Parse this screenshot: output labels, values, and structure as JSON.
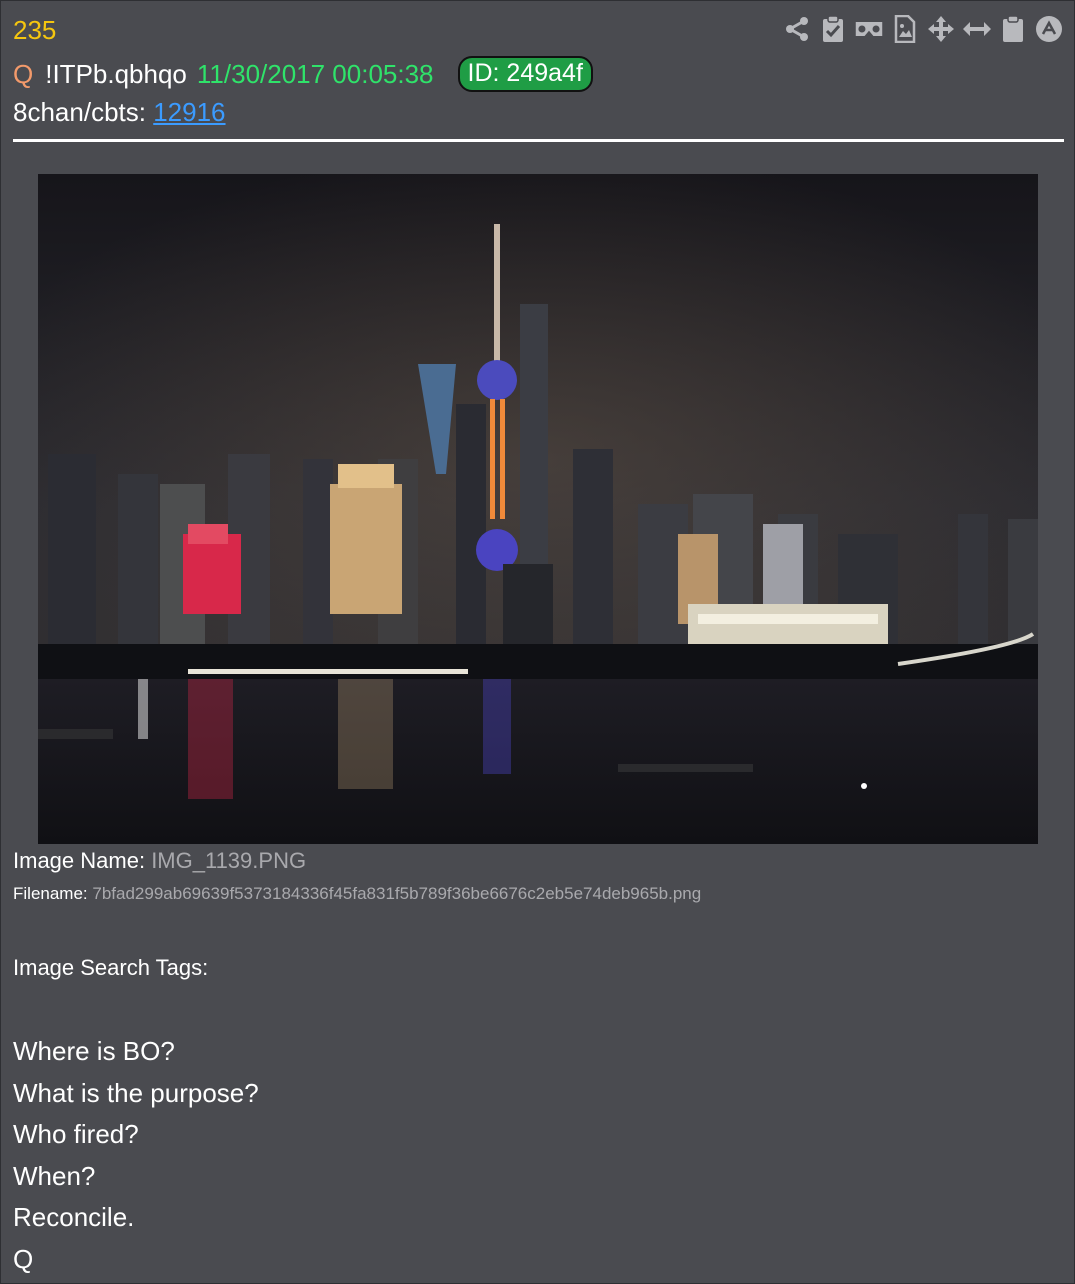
{
  "post": {
    "number": "235",
    "author_mark": "Q",
    "tripcode": "!ITPb.qbhqo",
    "timestamp": "11/30/2017 00:05:38",
    "id_badge": "ID: 249a4f",
    "board_label": "8chan/cbts:",
    "board_link": "12916"
  },
  "toolbar": {
    "icons": [
      "share-icon",
      "clipboard-check-icon",
      "vr-goggles-icon",
      "image-file-icon",
      "move-arrows-icon",
      "horizontal-arrows-icon",
      "clipboard-icon",
      "circle-up-icon"
    ]
  },
  "image": {
    "name_label": "Image Name:",
    "name_value": "IMG_1139.PNG",
    "filename_label": "Filename:",
    "filename_value": "7bfad299ab69639f5373184336f45fa831f5b789f36be6676c2eb5e74deb965b.png",
    "search_tags_label": "Image Search Tags:"
  },
  "message": {
    "lines": [
      "Where is BO?",
      "What is the purpose?",
      "Who fired?",
      "When?",
      "Reconcile.",
      "Q"
    ]
  },
  "colors": {
    "background": "#4a4b50",
    "post_number": "#f5c60f",
    "author_mark": "#f39a6b",
    "timestamp": "#2fe36a",
    "id_badge": "#1f9d45",
    "link": "#3b9bff",
    "muted_value": "#a9a9ad"
  }
}
